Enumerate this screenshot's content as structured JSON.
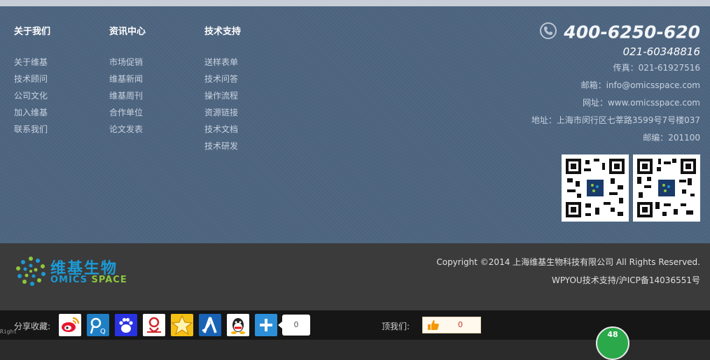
{
  "nav": {
    "columns": [
      {
        "title": "关于我们",
        "items": [
          "关于维基",
          "技术顾问",
          "公司文化",
          "加入维基",
          "联系我们"
        ]
      },
      {
        "title": "资讯中心",
        "items": [
          "市场促销",
          "维基新闻",
          "维基周刊",
          "合作单位",
          "论文发表"
        ]
      },
      {
        "title": "技术支持",
        "items": [
          "送样表单",
          "技术问答",
          "操作流程",
          "资源链接",
          "技术文档",
          "技术研发"
        ]
      }
    ]
  },
  "contact": {
    "phone_main": "400-6250-620",
    "phone_sub": "021-60348816",
    "fax": "传真：021-61927516",
    "email": "邮箱：info@omicsspace.com",
    "website": "网址：www.omicsspace.com",
    "address": "地址：上海市闵行区七莘路3599号7号楼037",
    "postcode": "邮编：201100"
  },
  "logo": {
    "cn": "维基生物",
    "en_1": "OMICS",
    "en_2": "SPACE"
  },
  "footer": {
    "copyright": "Copyright ©2014 上海维基生物科技有限公司 All Rights Reserved.",
    "icp": "WPYOU技术支持/沪ICP备14036551号"
  },
  "share": {
    "label": "分享收藏:",
    "count": "0",
    "icons": [
      "weibo-icon",
      "tencent-weibo-icon",
      "baidu-icon",
      "renren-share-icon",
      "qzone-icon",
      "renren-icon",
      "qq-icon",
      "more-share-icon"
    ]
  },
  "like": {
    "label": "顶我们:",
    "count": "0"
  },
  "badge": {
    "value": "48"
  },
  "tiny_text": "Right"
}
